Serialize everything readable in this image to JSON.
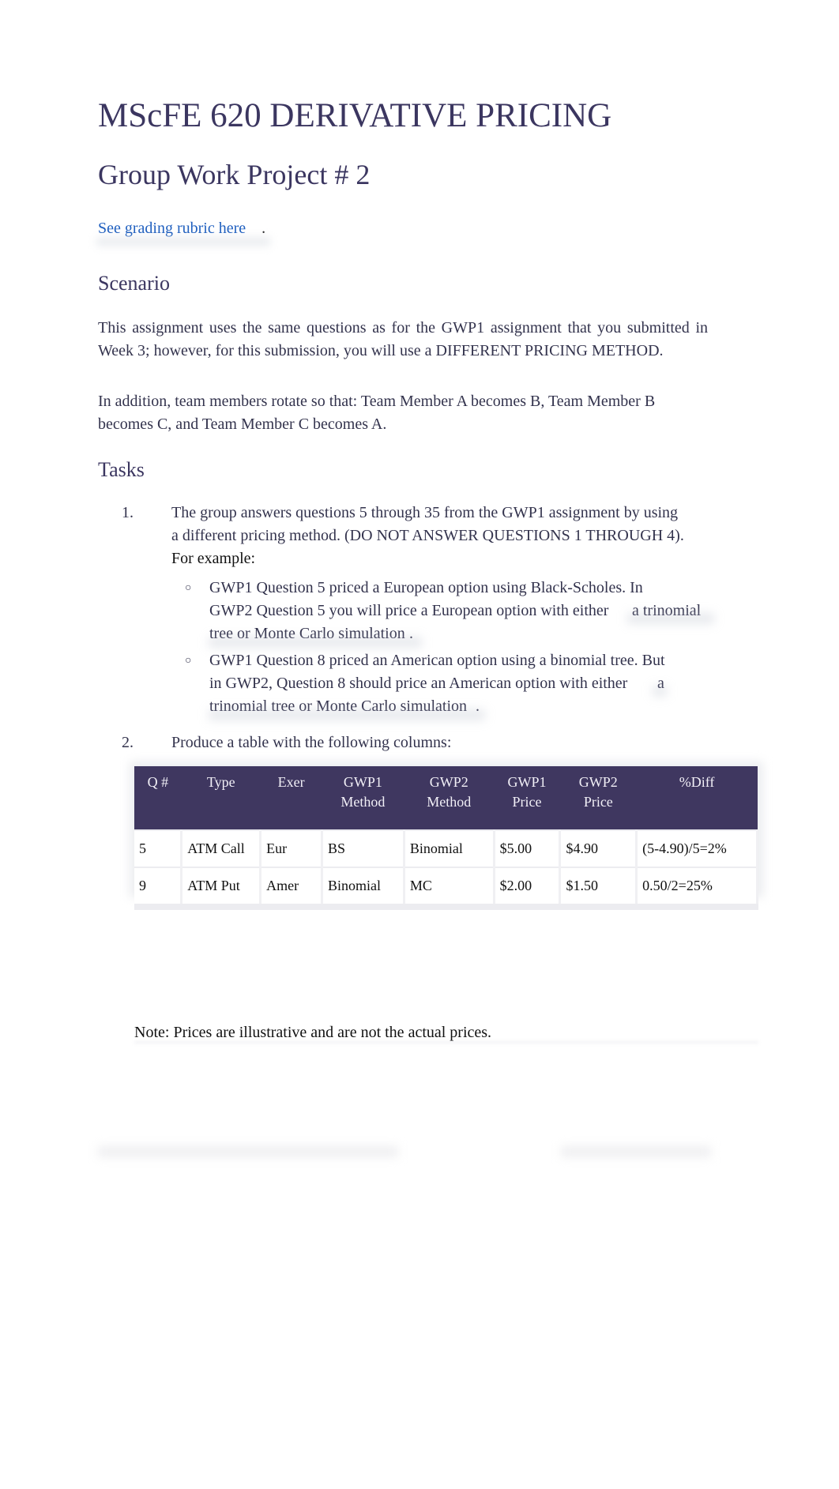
{
  "document": {
    "title": "MScFE 620 DERIVATIVE PRICING",
    "subtitle": "Group Work Project # 2",
    "rubric_link": "See grading rubric here",
    "rubric_period": "."
  },
  "scenario": {
    "heading": "Scenario",
    "paragraphs": [
      "This assignment uses the same questions as for the GWP1 assignment that you submitted in Week 3; however, for this submission, you will use a DIFFERENT PRICING METHOD.",
      "In addition, team members rotate so that: Team Member A becomes B, Team Member B becomes C, and Team Member C becomes A."
    ]
  },
  "tasks": {
    "heading": "Tasks",
    "items": [
      {
        "number": "1.",
        "line1": "The group answers questions 5 through 35 from the GWP1 assignment by using",
        "line2": "a different pricing method. (DO NOT ANSWER QUESTIONS 1 THROUGH 4).",
        "for_example": "For example:",
        "bullets": [
          {
            "line1": "GWP1 Question 5 priced a European option using Black-Scholes. In",
            "line2a": "GWP2 Question 5 you will price a European option with either",
            "line2b": "a trinomial",
            "line3": "tree or Monte Carlo simulation",
            "end": "."
          },
          {
            "line1": "GWP1 Question 8 priced an American option using a binomial tree. But",
            "line2a": "in GWP2, Question 8 should price an American option with either",
            "line2b": "a",
            "line3": "trinomial tree or Monte Carlo simulation",
            "end": "."
          }
        ]
      },
      {
        "number": "2.",
        "line1": "Produce a table with the following columns:"
      }
    ],
    "bullet_icon": "hollow-circle-bullet"
  },
  "table": {
    "header_color": "#3f3760",
    "columns": [
      {
        "l1": "Q #",
        "l2": ""
      },
      {
        "l1": "Type",
        "l2": ""
      },
      {
        "l1": "Exer",
        "l2": ""
      },
      {
        "l1": "GWP1",
        "l2": "Method"
      },
      {
        "l1": "GWP2",
        "l2": "Method"
      },
      {
        "l1": "GWP1",
        "l2": "Price"
      },
      {
        "l1": "GWP2",
        "l2": "Price"
      },
      {
        "l1": "%Diff",
        "l2": ""
      }
    ],
    "rows": [
      [
        "5",
        "ATM Call",
        "Eur",
        "BS",
        "Binomial",
        "$5.00",
        "$4.90",
        "(5-4.90)/5=2%"
      ],
      [
        "9",
        "ATM Put",
        "Amer",
        "Binomial",
        "MC",
        "$2.00",
        "$1.50",
        "0.50/2=25%"
      ]
    ]
  },
  "note": {
    "label": "Note",
    "text": "Prices are illustrative and are not the actual prices."
  }
}
